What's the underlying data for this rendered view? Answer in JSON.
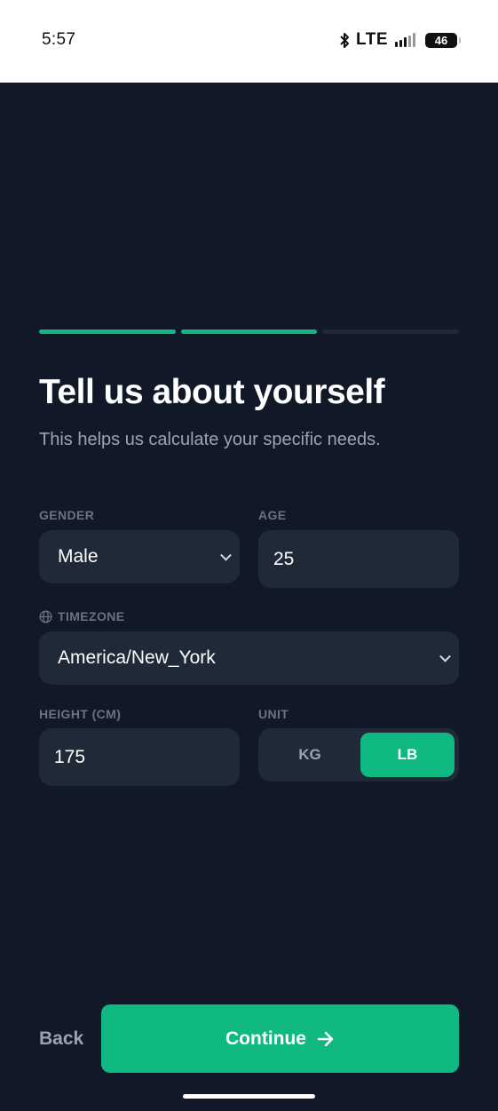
{
  "status_bar": {
    "time": "5:57",
    "network": "LTE",
    "battery": "46",
    "icons": [
      "bluetooth-icon",
      "signal-icon",
      "battery-icon"
    ]
  },
  "progress": {
    "total_steps": 3,
    "completed_steps": 2
  },
  "header": {
    "title": "Tell us about yourself",
    "subtitle": "This helps us calculate your specific needs."
  },
  "form": {
    "gender": {
      "label": "GENDER",
      "value": "Male"
    },
    "age": {
      "label": "AGE",
      "value": "25"
    },
    "timezone": {
      "label": "TIMEZONE",
      "value": "America/New_York",
      "icon": "globe-icon"
    },
    "height": {
      "label": "HEIGHT (CM)",
      "value": "175"
    },
    "unit": {
      "label": "UNIT",
      "options": [
        "KG",
        "LB"
      ],
      "selected": "LB"
    }
  },
  "footer": {
    "back_label": "Back",
    "continue_label": "Continue",
    "continue_icon": "arrow-right-icon"
  },
  "colors": {
    "accent": "#10b981",
    "background": "#111827",
    "field": "#1f2937",
    "muted_text": "#9ca3af"
  }
}
